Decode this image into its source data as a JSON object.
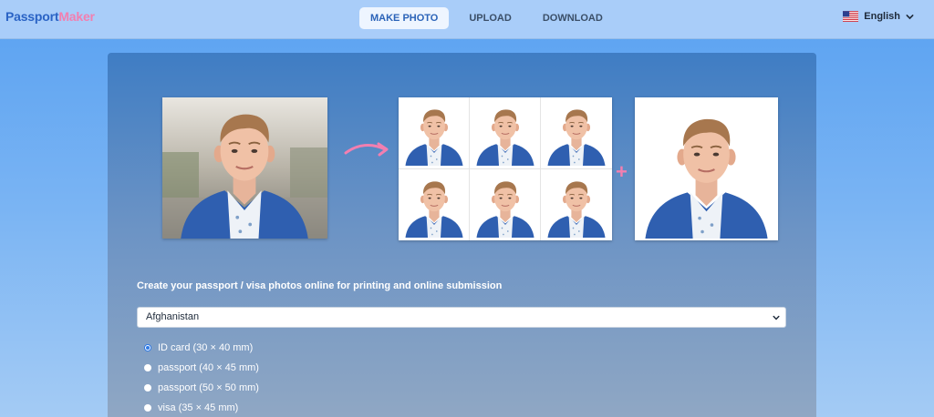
{
  "header": {
    "logo_part1": "Passport",
    "logo_part2": "Maker",
    "nav": [
      "MAKE PHOTO",
      "UPLOAD",
      "DOWNLOAD"
    ],
    "active_nav": "MAKE PHOTO",
    "language": "English",
    "flag_icon": "us-flag-icon"
  },
  "main": {
    "tagline": "Create your passport / visa photos online for printing and online submission",
    "country_selected": "Afghanistan",
    "document_options": [
      {
        "label": "ID card (30 × 40 mm)",
        "checked": true
      },
      {
        "label": "passport (40 × 45 mm)",
        "checked": false
      },
      {
        "label": "passport (50 × 50 mm)",
        "checked": false
      },
      {
        "label": "visa (35 × 45 mm)",
        "checked": false
      }
    ],
    "accent_color": "#f27fb0",
    "brand_color": "#2a63c5"
  }
}
